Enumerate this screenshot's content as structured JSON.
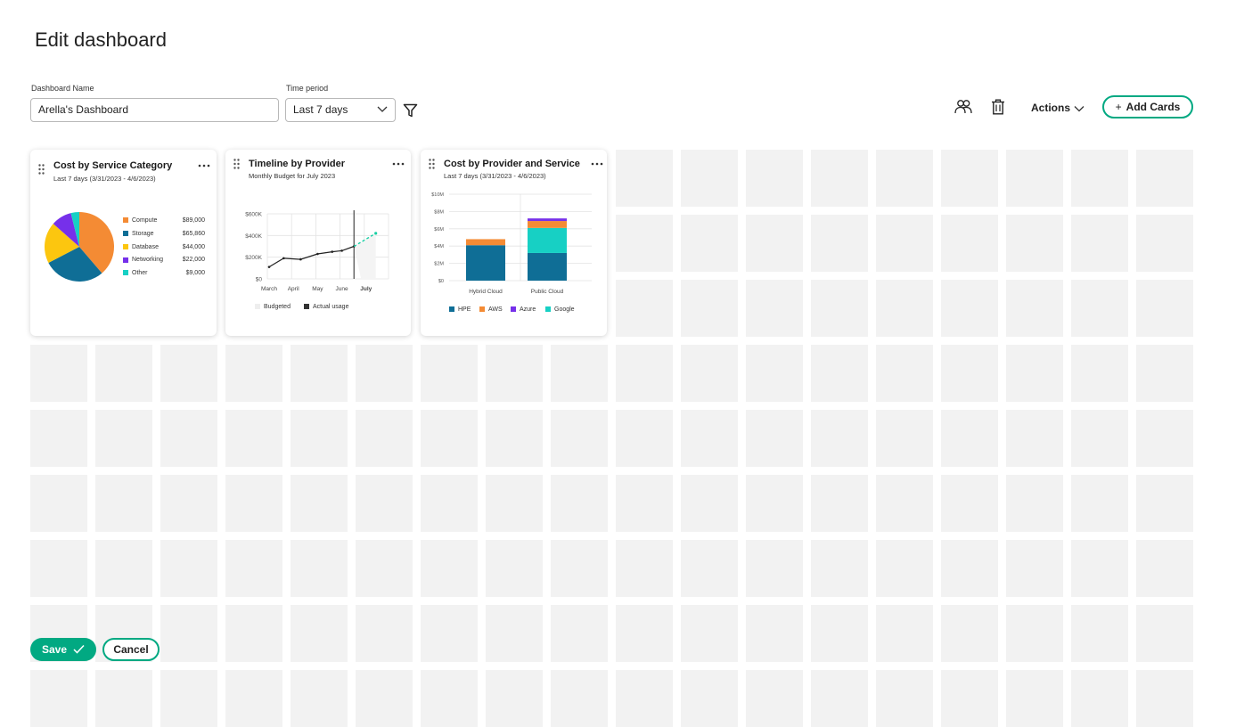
{
  "page": {
    "title": "Edit dashboard"
  },
  "form": {
    "name_label": "Dashboard Name",
    "name_value": "Arella's Dashboard",
    "period_label": "Time period",
    "period_value": "Last 7 days"
  },
  "toolbar": {
    "actions_label": "Actions",
    "add_cards_label": "Add Cards",
    "add_cards_icon": "plus-icon"
  },
  "colors": {
    "accent": "#01a982",
    "grid_cell": "#f2f2f2"
  },
  "cards": {
    "service": {
      "title": "Cost by Service Category",
      "subtitle": "Last 7 days (3/31/2023 - 4/6/2023)",
      "legend": [
        {
          "label": "Compute",
          "value": "$89,000",
          "color": "#f48b34"
        },
        {
          "label": "Storage",
          "value": "$65,860",
          "color": "#0f6e96"
        },
        {
          "label": "Database",
          "value": "$44,000",
          "color": "#fcc60f"
        },
        {
          "label": "Networking",
          "value": "$22,000",
          "color": "#7630ea"
        },
        {
          "label": "Other",
          "value": "$9,000",
          "color": "#17d0c4"
        }
      ]
    },
    "timeline": {
      "title": "Timeline by Provider",
      "subtitle": "Monthly Budget for July 2023",
      "legend": [
        "Budgeted",
        "Actual usage"
      ]
    },
    "provider": {
      "title": "Cost by Provider and Service",
      "subtitle": "Last 7 days (3/31/2023 - 4/6/2023)",
      "legend": [
        {
          "label": "HPE",
          "color": "#0f6e96"
        },
        {
          "label": "AWS",
          "color": "#f48b34"
        },
        {
          "label": "Azure",
          "color": "#7630ea"
        },
        {
          "label": "Google",
          "color": "#17d0c4"
        }
      ]
    }
  },
  "chart_data": [
    {
      "type": "pie",
      "title": "Cost by Service Category",
      "subtitle": "Last 7 days (3/31/2023 - 4/6/2023)",
      "categories": [
        "Compute",
        "Storage",
        "Database",
        "Networking",
        "Other"
      ],
      "values": [
        89000,
        65860,
        44000,
        22000,
        9000
      ],
      "colors": [
        "#f48b34",
        "#0f6e96",
        "#fcc60f",
        "#7630ea",
        "#17d0c4"
      ],
      "legend": "right"
    },
    {
      "type": "line",
      "title": "Timeline by Provider",
      "subtitle": "Monthly Budget for July 2023",
      "categories": [
        "March",
        "April",
        "May",
        "June",
        "July"
      ],
      "y_ticks": [
        "$0",
        "$200K",
        "$400K",
        "$600K"
      ],
      "ylim": [
        0,
        600000
      ],
      "series": [
        {
          "name": "Actual usage",
          "points": [
            [
              0,
              110000
            ],
            [
              0.6,
              190000
            ],
            [
              1.3,
              180000
            ],
            [
              2,
              230000
            ],
            [
              2.6,
              250000
            ],
            [
              3,
              260000
            ],
            [
              3.5,
              300000
            ]
          ]
        },
        {
          "name": "Budgeted",
          "forecast": [
            [
              3.5,
              300000
            ],
            [
              4.4,
              420000
            ]
          ]
        }
      ],
      "marker": "July",
      "grid": true,
      "legend": "bottom"
    },
    {
      "type": "bar",
      "title": "Cost by Provider and Service",
      "subtitle": "Last 7 days (3/31/2023 - 4/6/2023)",
      "categories": [
        "Hybrid Cloud",
        "Public Cloud"
      ],
      "y_ticks": [
        "$0",
        "$2M",
        "$4M",
        "$6M",
        "$8M",
        "$10M"
      ],
      "ylim": [
        0,
        10000000
      ],
      "series": [
        {
          "name": "HPE",
          "values": [
            4100000,
            3200000
          ]
        },
        {
          "name": "AWS",
          "values": [
            700000,
            800000
          ]
        },
        {
          "name": "Azure",
          "values": [
            0,
            300000
          ]
        },
        {
          "name": "Google",
          "values": [
            0,
            2900000
          ]
        }
      ],
      "stacked": true,
      "grid": true,
      "legend": "bottom"
    }
  ],
  "grid": {
    "columns": 18,
    "rows": 9
  },
  "footer": {
    "save_label": "Save",
    "cancel_label": "Cancel"
  }
}
